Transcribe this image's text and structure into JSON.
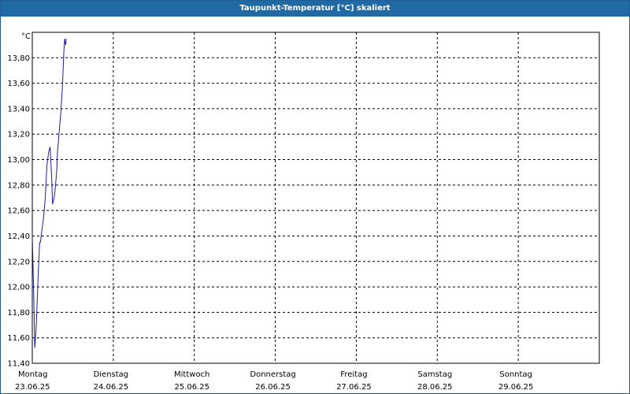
{
  "window": {
    "title": "Taupunkt-Temperatur [°C] skaliert"
  },
  "chart_data": {
    "type": "line",
    "title": "Taupunkt-Temperatur [°C] skaliert",
    "ylabel": "°C",
    "xlabel": "",
    "ylim": [
      11.4,
      14.0
    ],
    "y_ticks": [
      "11,40",
      "11,60",
      "11,80",
      "12,00",
      "12,20",
      "12,40",
      "12,60",
      "12,80",
      "13,00",
      "13,20",
      "13,40",
      "13,60",
      "13,80"
    ],
    "y_tick_values": [
      11.4,
      11.6,
      11.8,
      12.0,
      12.2,
      12.4,
      12.6,
      12.8,
      13.0,
      13.2,
      13.4,
      13.6,
      13.8
    ],
    "x_range_days": [
      0,
      7
    ],
    "x_ticks": [
      {
        "day": "Montag",
        "date": "23.06.25"
      },
      {
        "day": "Dienstag",
        "date": "24.06.25"
      },
      {
        "day": "Mittwoch",
        "date": "25.06.25"
      },
      {
        "day": "Donnerstag",
        "date": "26.06.25"
      },
      {
        "day": "Freitag",
        "date": "27.06.25"
      },
      {
        "day": "Samstag",
        "date": "28.06.25"
      },
      {
        "day": "Sonntag",
        "date": "29.06.25"
      }
    ],
    "grid": true,
    "series": [
      {
        "color": "#1a1aa8",
        "x": [
          0.0,
          0.01,
          0.02,
          0.03,
          0.04,
          0.05,
          0.07,
          0.09,
          0.1,
          0.12,
          0.14,
          0.16,
          0.18,
          0.2,
          0.22,
          0.24,
          0.25,
          0.27,
          0.28,
          0.3,
          0.31,
          0.33,
          0.35,
          0.37,
          0.38,
          0.39,
          0.4,
          0.41,
          0.42
        ],
        "y": [
          12.4,
          12.15,
          11.85,
          11.52,
          11.6,
          11.7,
          12.05,
          12.35,
          12.35,
          12.45,
          12.55,
          12.7,
          12.95,
          13.05,
          13.1,
          12.85,
          12.65,
          12.7,
          12.75,
          12.9,
          13.05,
          13.2,
          13.35,
          13.55,
          13.7,
          13.85,
          13.95,
          13.9,
          13.95
        ]
      }
    ]
  },
  "colors": {
    "titlebar": "#1f6aa5",
    "line": "#1a1aa8",
    "grid": "#000000"
  }
}
